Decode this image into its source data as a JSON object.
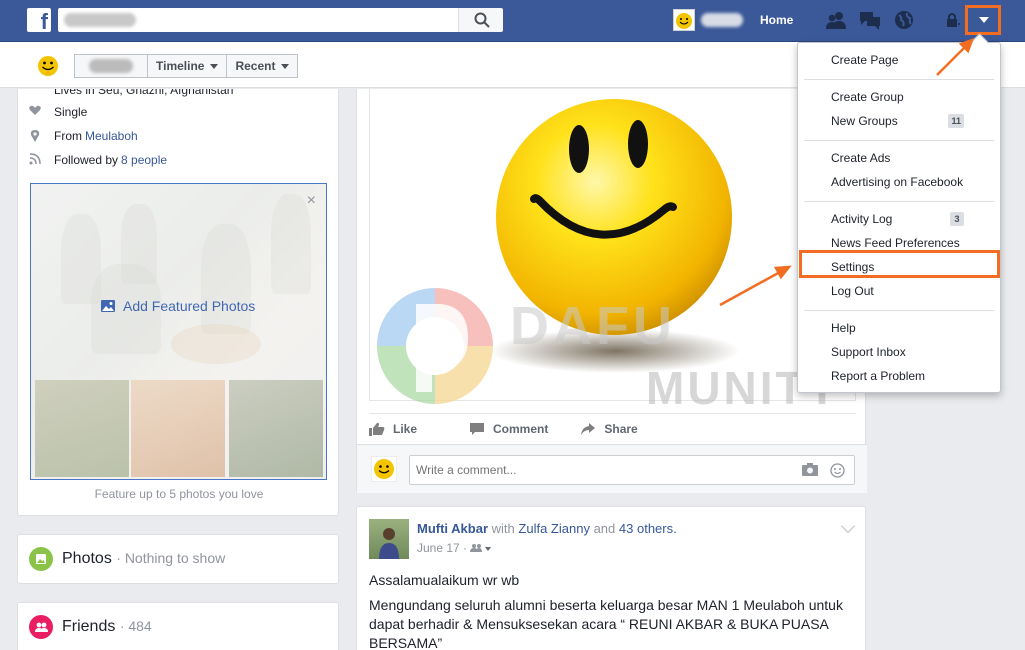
{
  "topbar": {
    "logo": "f",
    "search_placeholder": "",
    "home_label": "Home"
  },
  "subheader": {
    "tabs": [
      {
        "label": "Timeline"
      },
      {
        "label": "Recent"
      }
    ]
  },
  "intro": {
    "cut_line": "Lives in Seu, Ghazni, Afghanistan",
    "relationship": "Single",
    "from_prefix": "From",
    "from_place": "Meulaboh",
    "followed_prefix": "Followed by",
    "followed_link": "8 people",
    "featured_label": "Add Featured Photos",
    "featured_caption": "Feature up to 5 photos you love"
  },
  "sections": {
    "photos_title": "Photos",
    "photos_sub": "· Nothing to show",
    "friends_title": "Friends",
    "friends_sub": "· 484"
  },
  "post": {
    "like": "Like",
    "comment": "Comment",
    "share": "Share",
    "comment_placeholder": "Write a comment..."
  },
  "post2": {
    "author": "Mufti Akbar",
    "with": "with",
    "tagged": "Zulfa Zianny",
    "and": "and",
    "others": "43 others.",
    "date": "June 17 ·",
    "line1": "Assalamualaikum wr wb",
    "line2": "Mengundang seluruh alumni beserta keluarga besar MAN 1 Meulaboh untuk dapat berhadir & Mensuksesekan acara “ REUNI AKBAR & BUKA PUASA BERSAMA”"
  },
  "dropdown": {
    "items": [
      {
        "label": "Create Page"
      },
      {
        "label": "Create Group"
      },
      {
        "label": "New Groups",
        "badge": "11"
      },
      {
        "label": "Create Ads"
      },
      {
        "label": "Advertising on Facebook"
      },
      {
        "label": "Activity Log",
        "badge": "3"
      },
      {
        "label": "News Feed Preferences"
      },
      {
        "label": "Settings"
      },
      {
        "label": "Log Out"
      },
      {
        "label": "Help"
      },
      {
        "label": "Support Inbox"
      },
      {
        "label": "Report a Problem"
      }
    ]
  },
  "watermark": {
    "line1": "DAFU",
    "line2": "MUNITY"
  },
  "colors": {
    "brand": "#3b5998",
    "highlight": "#f26d21",
    "link": "#365899",
    "photos_badge": "#8bc34a",
    "friends_badge": "#e91e63"
  },
  "icons": [
    "search-icon",
    "friends-icon",
    "messages-icon",
    "globe-icon",
    "lock-icon",
    "caret-down-icon",
    "heart-icon",
    "pin-icon",
    "rss-icon",
    "close-icon",
    "photo-icon",
    "like-icon",
    "comment-icon",
    "share-icon",
    "camera-icon",
    "emoji-icon"
  ]
}
